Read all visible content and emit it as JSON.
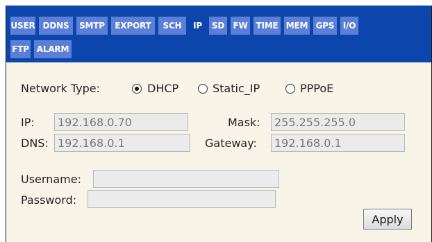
{
  "tabs": [
    {
      "label": "USER",
      "active": false
    },
    {
      "label": "DDNS",
      "active": false
    },
    {
      "label": "SMTP",
      "active": false
    },
    {
      "label": "EXPORT",
      "active": false
    },
    {
      "label": "SCH",
      "active": false
    },
    {
      "label": "IP",
      "active": true
    },
    {
      "label": "SD",
      "active": false
    },
    {
      "label": "FW",
      "active": false
    },
    {
      "label": "TIME",
      "active": false
    },
    {
      "label": "MEM",
      "active": false
    },
    {
      "label": "GPS",
      "active": false
    },
    {
      "label": "I/O",
      "active": false
    },
    {
      "label": "FTP",
      "active": false
    },
    {
      "label": "ALARM",
      "active": false
    }
  ],
  "network": {
    "type_label": "Network Type:",
    "options": [
      {
        "label": "DHCP",
        "selected": true
      },
      {
        "label": "Static_IP",
        "selected": false
      },
      {
        "label": "PPPoE",
        "selected": false
      }
    ]
  },
  "fields": {
    "ip_label": "IP:",
    "ip_value": "192.168.0.70",
    "mask_label": "Mask:",
    "mask_value": "255.255.255.0",
    "dns_label": "DNS:",
    "dns_value": "192.168.0.1",
    "gateway_label": "Gateway:",
    "gateway_value": "192.168.0.1",
    "username_label": "Username:",
    "username_value": "",
    "password_label": "Password:",
    "password_value": ""
  },
  "apply_label": "Apply",
  "colors": {
    "tabbar": "#0c46ad",
    "tab": "#5b7fd6",
    "content_bg": "#f8f4e7"
  }
}
